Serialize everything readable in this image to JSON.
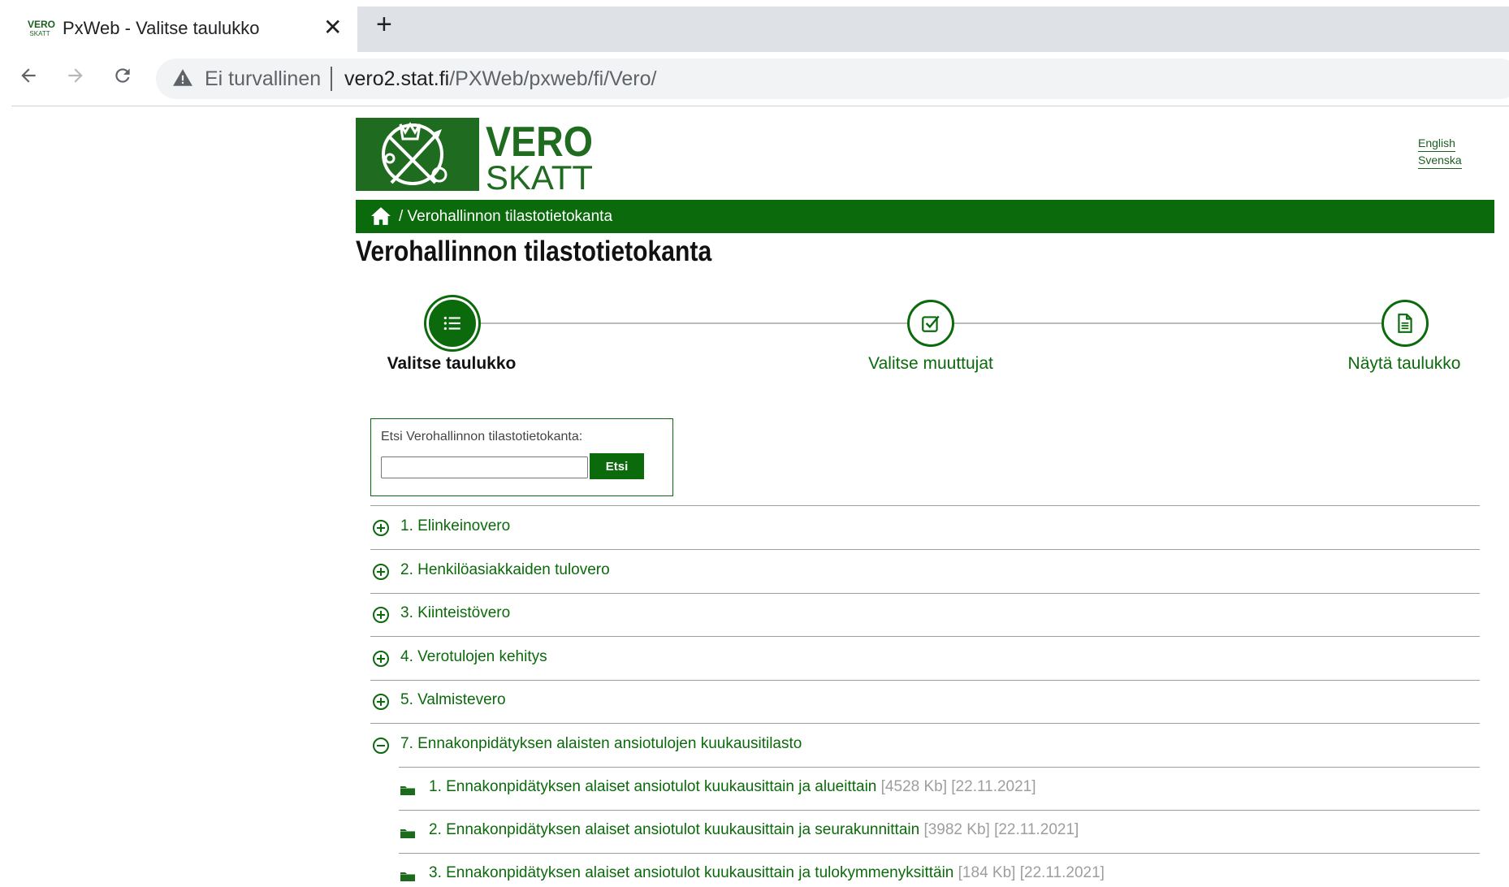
{
  "browser": {
    "favicon_text_top": "VERO",
    "favicon_text_bottom": "SKATT",
    "tab_title": "PxWeb - Valitse taulukko",
    "tab_close": "✕",
    "new_tab": "+",
    "security_label": "Ei turvallinen",
    "url_host": "vero2.stat.fi",
    "url_path": "/PXWeb/pxweb/fi/Vero/"
  },
  "header": {
    "logo_line1": "VERO",
    "logo_line2": "SKATT",
    "lang_english": "English",
    "lang_svenska": "Svenska",
    "breadcrumb": "/ Verohallinnon tilastotietokanta",
    "page_title": "Verohallinnon tilastotietokanta"
  },
  "stepper": {
    "steps": [
      {
        "label": "Valitse taulukko",
        "icon": "list-icon",
        "active": true
      },
      {
        "label": "Valitse muuttujat",
        "icon": "checkbox-icon",
        "active": false
      },
      {
        "label": "Näytä taulukko",
        "icon": "document-icon",
        "active": false
      }
    ]
  },
  "search": {
    "label": "Etsi Verohallinnon tilastotietokanta:",
    "value": "",
    "button_label": "Etsi"
  },
  "tree": {
    "items": [
      {
        "label": "1. Elinkeinovero",
        "expanded": false
      },
      {
        "label": "2. Henkilöasiakkaiden tulovero",
        "expanded": false
      },
      {
        "label": "3. Kiinteistövero",
        "expanded": false
      },
      {
        "label": "4. Verotulojen kehitys",
        "expanded": false
      },
      {
        "label": "5. Valmistevero",
        "expanded": false
      },
      {
        "label": "7. Ennakonpidätyksen alaisten ansiotulojen kuukausitilasto",
        "expanded": true
      }
    ],
    "sub_items": [
      {
        "label": "1. Ennakonpidätyksen alaiset ansiotulot kuukausittain ja alueittain",
        "size": "[4528 Kb]",
        "date": "[22.11.2021]"
      },
      {
        "label": "2. Ennakonpidätyksen alaiset ansiotulot kuukausittain ja seurakunnittain",
        "size": "[3982 Kb]",
        "date": "[22.11.2021]"
      },
      {
        "label": "3. Ennakonpidätyksen alaiset ansiotulot kuukausittain ja tulokymmenyksittäin",
        "size": "[184 Kb]",
        "date": "[22.11.2021]"
      }
    ]
  },
  "colors": {
    "brand_green": "#0b6a0b",
    "meta_gray": "#9e9e9e"
  }
}
